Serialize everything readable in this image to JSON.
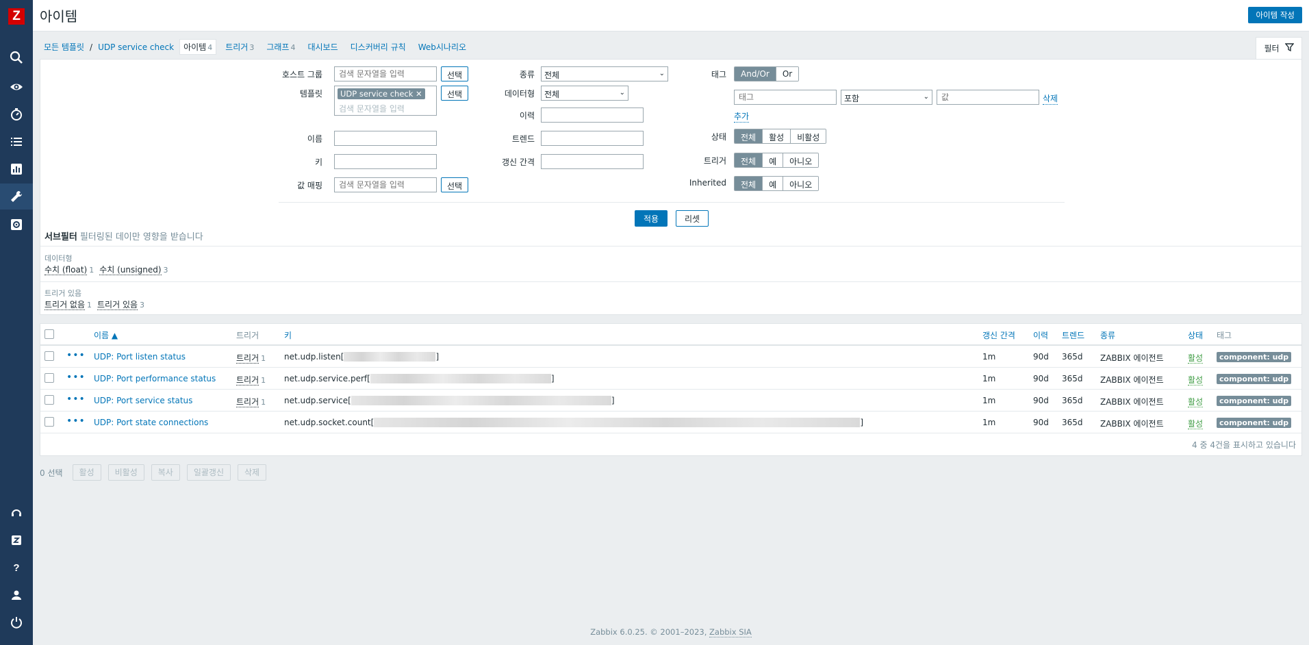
{
  "header": {
    "title": "아이템",
    "create_button": "아이템 작성"
  },
  "nav": {
    "all_templates": "모든 템플릿",
    "separator": "/",
    "template": "UDP service check",
    "tabs": [
      {
        "label": "아이템",
        "count": "4"
      },
      {
        "label": "트리거",
        "count": "3"
      },
      {
        "label": "그래프",
        "count": "4"
      },
      {
        "label": "대시보드",
        "count": ""
      },
      {
        "label": "디스커버리 규칙",
        "count": ""
      },
      {
        "label": "Web시나리오",
        "count": ""
      }
    ],
    "filter_tab": "필터"
  },
  "filter": {
    "host_group_label": "호스트 그룹",
    "host_group_placeholder": "검색 문자열을 입력",
    "select_label": "선택",
    "template_label": "템플릿",
    "template_chip": "UDP service check",
    "template_placeholder": "검색 문자열을 입력",
    "name_label": "이름",
    "key_label": "키",
    "valuemap_label": "값 매핑",
    "valuemap_placeholder": "검색 문자열을 입력",
    "type_label": "종류",
    "type_value": "전체",
    "datatype_label": "데이터형",
    "datatype_value": "전체",
    "history_label": "이력",
    "trends_label": "트렌드",
    "interval_label": "갱신 간격",
    "tags_label": "태그",
    "tags_andor": "And/Or",
    "tags_or": "Or",
    "tag_placeholder": "태그",
    "tag_operator": "포함",
    "tag_value_placeholder": "값",
    "tag_delete": "삭제",
    "tag_add": "추가",
    "state_label": "상태",
    "state_options": [
      "전체",
      "활성",
      "비활성"
    ],
    "triggers_label": "트리거",
    "triggers_options": [
      "전체",
      "예",
      "아니오"
    ],
    "inherited_label": "Inherited",
    "inherited_options": [
      "전체",
      "예",
      "아니오"
    ],
    "apply": "적용",
    "reset": "리셋"
  },
  "subfilter": {
    "title": "서브필터",
    "subtitle": "필터링된 데이만 영향을 받습니다",
    "datatype_title": "데이터형",
    "datatype_items": [
      {
        "label": "수치 (float)",
        "count": "1"
      },
      {
        "label": "수치 (unsigned)",
        "count": "3"
      }
    ],
    "has_trigger_title": "트리거 있음",
    "has_trigger_items": [
      {
        "label": "트리거 없음",
        "count": "1"
      },
      {
        "label": "트리거 있음",
        "count": "3"
      }
    ]
  },
  "table": {
    "columns": {
      "name": "이름 ▲",
      "triggers": "트리거",
      "key": "키",
      "interval": "갱신 간격",
      "history": "이력",
      "trends": "트렌드",
      "type": "종류",
      "status": "상태",
      "tags": "태그"
    },
    "rows": [
      {
        "name": "UDP: Port listen status",
        "trigger": "트리거",
        "trigger_count": "1",
        "key_prefix": "net.udp.listen[",
        "key_suffix": "]",
        "interval": "1m",
        "history": "90d",
        "trends": "365d",
        "type": "ZABBIX 에이전트",
        "status": "활성",
        "tag": "component: udp"
      },
      {
        "name": "UDP: Port performance status",
        "trigger": "트리거",
        "trigger_count": "1",
        "key_prefix": "net.udp.service.perf[",
        "key_suffix": "]",
        "interval": "1m",
        "history": "90d",
        "trends": "365d",
        "type": "ZABBIX 에이전트",
        "status": "활성",
        "tag": "component: udp"
      },
      {
        "name": "UDP: Port service status",
        "trigger": "트리거",
        "trigger_count": "1",
        "key_prefix": "net.udp.service[",
        "key_suffix": "]",
        "interval": "1m",
        "history": "90d",
        "trends": "365d",
        "type": "ZABBIX 에이전트",
        "status": "활성",
        "tag": "component: udp"
      },
      {
        "name": "UDP: Port state connections",
        "trigger": "",
        "trigger_count": "",
        "key_prefix": "net.udp.socket.count[",
        "key_suffix": "]",
        "interval": "1m",
        "history": "90d",
        "trends": "365d",
        "type": "ZABBIX 에이전트",
        "status": "활성",
        "tag": "component: udp"
      }
    ],
    "footer": "4 중 4건을 표시하고 있습니다"
  },
  "actions": {
    "selected": "0 선택",
    "buttons": [
      "활성",
      "비활성",
      "복사",
      "일괄갱신",
      "삭제"
    ]
  },
  "footer": {
    "text": "Zabbix 6.0.25. © 2001–2023,",
    "link": "Zabbix SIA"
  },
  "colors": {
    "sidebar": "#1f3a5a",
    "accent": "#0275b8",
    "enabled": "#429e47",
    "logo": "#d40000"
  }
}
